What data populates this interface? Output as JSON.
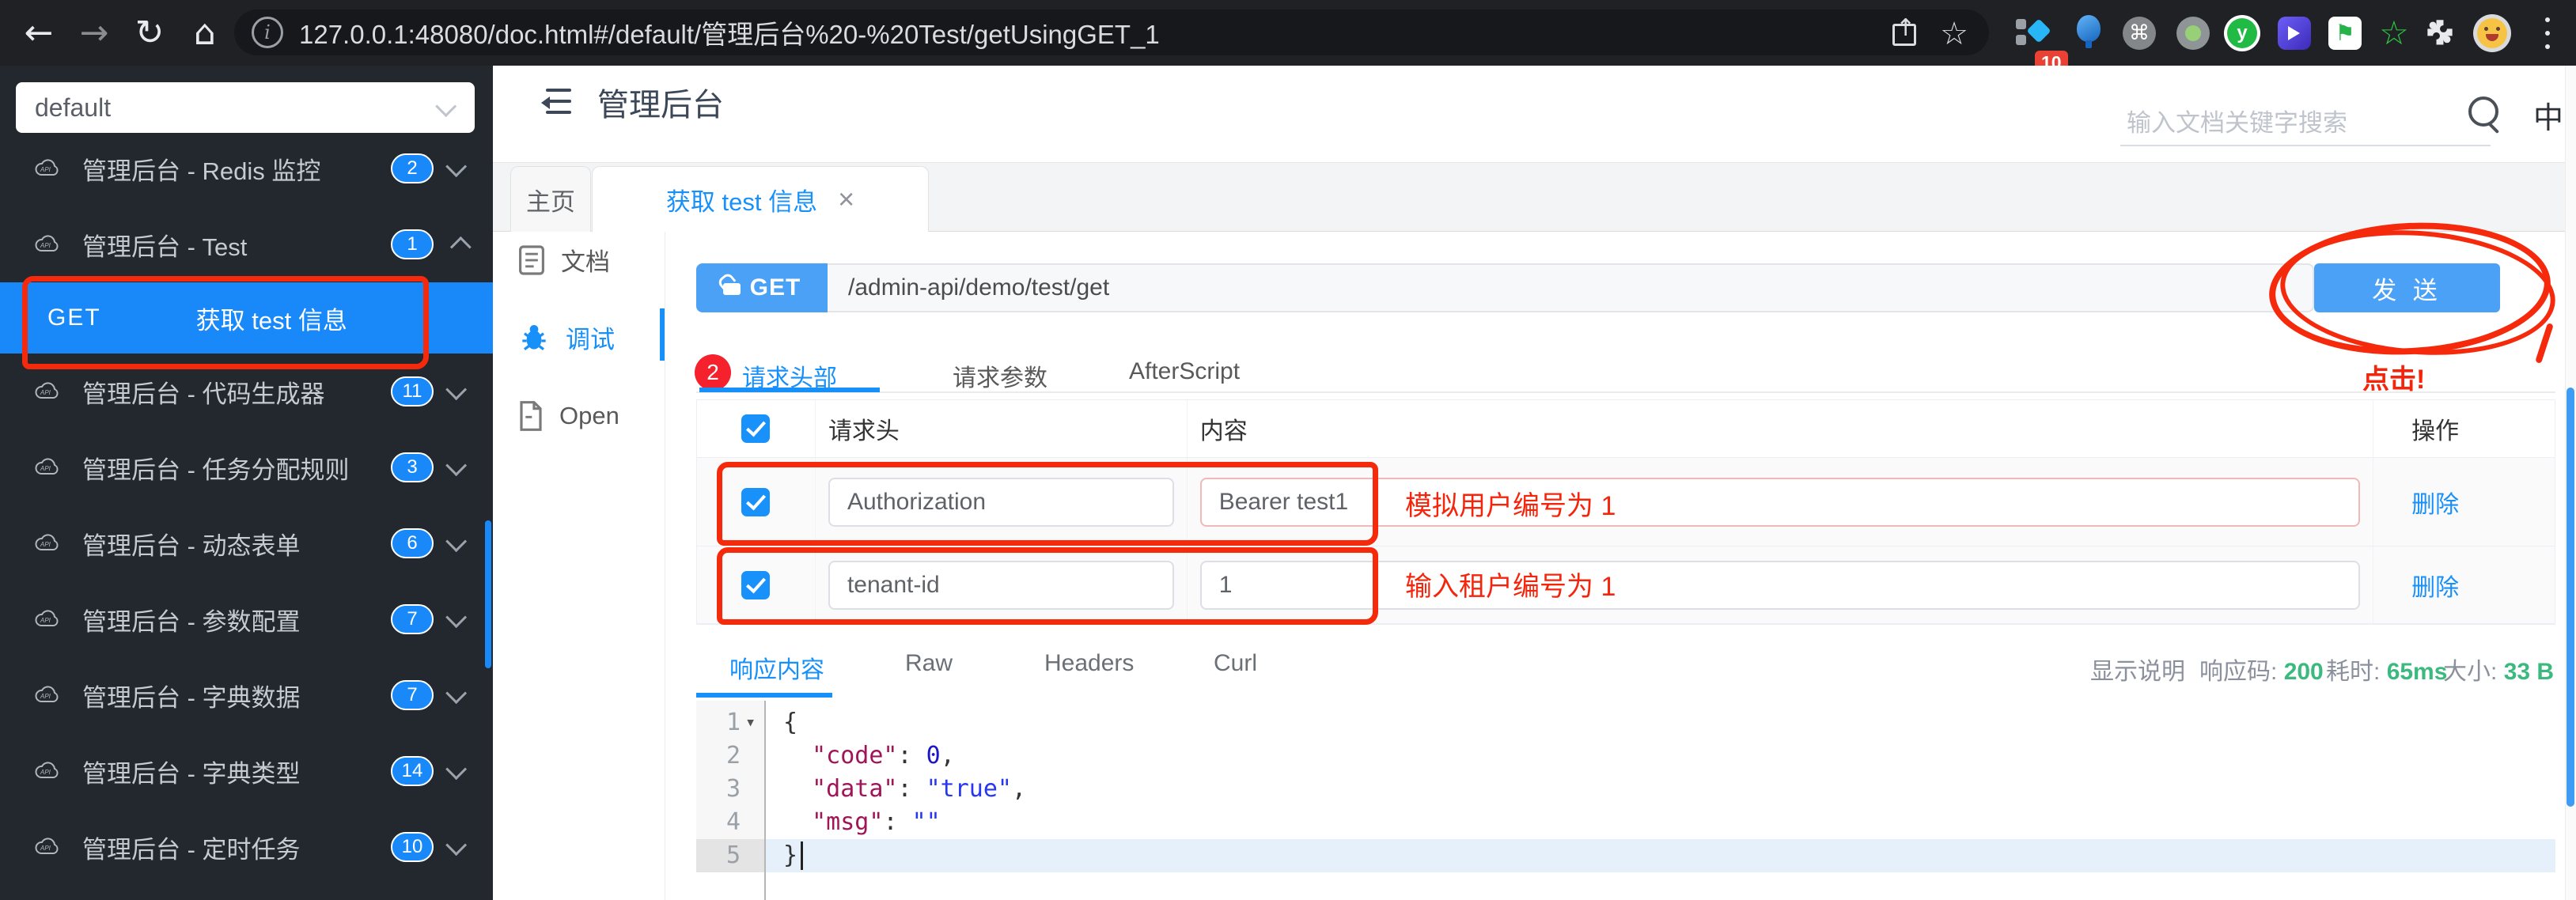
{
  "colors": {
    "accent": "#1890fa",
    "annotation_red": "#f5290b",
    "success_green": "#3cb97f",
    "method_blue": "#4ba1f5"
  },
  "chrome": {
    "url": "127.0.0.1:48080/doc.html#/default/管理后台%20-%20Test/getUsingGET_1",
    "extension_badge": "10",
    "extension_icons": [
      "pinned-ext-diamond",
      "balloon-ext",
      "command-ext",
      "record-ext",
      "v-green-ext",
      "shield-ext",
      "flag-ext",
      "star-green-ext",
      "puzzle-extensions",
      "profile-avatar",
      "menu-dots"
    ]
  },
  "sidebar": {
    "group_select_value": "default",
    "groups": [
      {
        "label": "管理后台 - Redis 监控",
        "count": "2",
        "expanded": false
      },
      {
        "label": "管理后台 - Test",
        "count": "1",
        "expanded": true
      },
      {
        "label": "管理后台 - 代码生成器",
        "count": "11",
        "expanded": false
      },
      {
        "label": "管理后台 - 任务分配规则",
        "count": "3",
        "expanded": false
      },
      {
        "label": "管理后台 - 动态表单",
        "count": "6",
        "expanded": false
      },
      {
        "label": "管理后台 - 参数配置",
        "count": "7",
        "expanded": false
      },
      {
        "label": "管理后台 - 字典数据",
        "count": "7",
        "expanded": false
      },
      {
        "label": "管理后台 - 字典类型",
        "count": "14",
        "expanded": false
      },
      {
        "label": "管理后台 - 定时任务",
        "count": "10",
        "expanded": false
      }
    ],
    "active_endpoint": {
      "method": "GET",
      "label": "获取 test 信息"
    }
  },
  "header": {
    "title": "管理后台",
    "search_placeholder": "输入文档关键字搜索",
    "lang_toggle": "中"
  },
  "doc_tabs": {
    "home": "主页",
    "active": "获取 test 信息",
    "close": "×"
  },
  "doc_nav": {
    "doc": "文档",
    "debug": "调试",
    "open": "Open"
  },
  "request": {
    "method": "GET",
    "url": "/admin-api/demo/test/get",
    "send_label": "发 送"
  },
  "request_tabs": {
    "badge": "2",
    "items": [
      "请求头部",
      "请求参数",
      "AfterScript"
    ]
  },
  "headers_table": {
    "columns": {
      "name": "请求头",
      "value": "内容",
      "action": "操作"
    },
    "rows": [
      {
        "checked": true,
        "name": "Authorization",
        "value": "Bearer test1",
        "action": "删除",
        "highlight": true
      },
      {
        "checked": true,
        "name": "tenant-id",
        "value": "1",
        "action": "删除",
        "highlight": false
      }
    ]
  },
  "response": {
    "tabs": [
      "响应内容",
      "Raw",
      "Headers",
      "Curl"
    ],
    "active_tab": "响应内容",
    "show_desc_label": "显示说明",
    "status_label": "响应码:",
    "status_value": "200",
    "time_label": "耗时:",
    "time_value": "65ms",
    "size_label": "大小:",
    "size_value": "33 B"
  },
  "editor": {
    "lines": [
      {
        "num": "1",
        "fold": true,
        "active": false,
        "tokens": [
          {
            "t": "{",
            "c": "plain"
          }
        ]
      },
      {
        "num": "2",
        "fold": false,
        "active": false,
        "tokens": [
          {
            "t": "  ",
            "c": "plain"
          },
          {
            "t": "\"code\"",
            "c": "key"
          },
          {
            "t": ": ",
            "c": "plain"
          },
          {
            "t": "0",
            "c": "num"
          },
          {
            "t": ",",
            "c": "plain"
          }
        ]
      },
      {
        "num": "3",
        "fold": false,
        "active": false,
        "tokens": [
          {
            "t": "  ",
            "c": "plain"
          },
          {
            "t": "\"data\"",
            "c": "key"
          },
          {
            "t": ": ",
            "c": "plain"
          },
          {
            "t": "\"true\"",
            "c": "str"
          },
          {
            "t": ",",
            "c": "plain"
          }
        ]
      },
      {
        "num": "4",
        "fold": false,
        "active": false,
        "tokens": [
          {
            "t": "  ",
            "c": "plain"
          },
          {
            "t": "\"msg\"",
            "c": "key"
          },
          {
            "t": ": ",
            "c": "plain"
          },
          {
            "t": "\"\"",
            "c": "str"
          }
        ]
      },
      {
        "num": "5",
        "fold": false,
        "active": true,
        "tokens": [
          {
            "t": "}",
            "c": "plain"
          }
        ]
      }
    ]
  },
  "annotations": {
    "row1_note": "模拟用户编号为 1",
    "row2_note": "输入租户编号为 1",
    "click_note": "点击!"
  }
}
